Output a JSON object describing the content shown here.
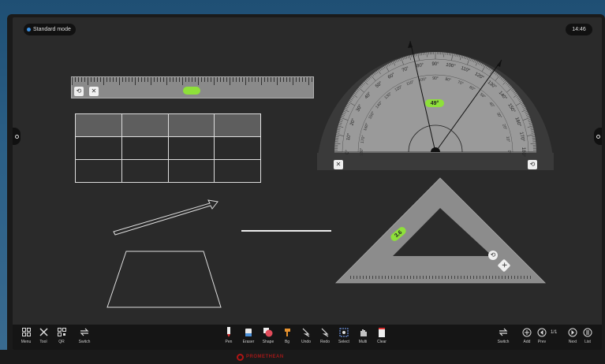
{
  "status": {
    "mode_label": "Standard mode",
    "clock": "14:46"
  },
  "protractor": {
    "angle_label": "49°",
    "outer_scale": [
      "0°",
      "10°",
      "20°",
      "30°",
      "40°",
      "50°",
      "60°",
      "70°",
      "80°",
      "90°",
      "100°",
      "110°",
      "120°",
      "130°",
      "140°",
      "150°",
      "160°",
      "170°",
      "180°"
    ],
    "inner_scale": [
      "180°",
      "170°",
      "160°",
      "150°",
      "140°",
      "130°",
      "120°",
      "110°",
      "100°",
      "90°",
      "80°",
      "70°",
      "60°",
      "50°",
      "40°",
      "30°",
      "20°",
      "10°",
      "0°"
    ]
  },
  "ruler": {
    "handle_label": ""
  },
  "triangle_ruler": {
    "handle_label": "3.6"
  },
  "toolbar": {
    "left": [
      {
        "label": "Menu",
        "icon": "menu-grid-icon"
      },
      {
        "label": "Tool",
        "icon": "tools-icon"
      },
      {
        "label": "QR",
        "icon": "qr-icon"
      },
      {
        "label": "Switch",
        "icon": "switch-icon"
      }
    ],
    "center": [
      {
        "label": "Pen",
        "icon": "pen-icon"
      },
      {
        "label": "Eraser",
        "icon": "eraser-icon"
      },
      {
        "label": "Shape",
        "icon": "shape-icon"
      },
      {
        "label": "Bg",
        "icon": "background-icon"
      },
      {
        "label": "Undo",
        "icon": "undo-icon"
      },
      {
        "label": "Redo",
        "icon": "redo-icon"
      },
      {
        "label": "Select",
        "icon": "select-icon"
      },
      {
        "label": "Multi",
        "icon": "multi-touch-icon"
      },
      {
        "label": "Clear",
        "icon": "clear-icon"
      }
    ],
    "right": [
      {
        "label": "Switch",
        "icon": "switch-icon"
      },
      {
        "label": "Add",
        "icon": "add-page-icon"
      },
      {
        "label": "Prev",
        "icon": "prev-page-icon"
      },
      {
        "label": "Next",
        "icon": "next-page-icon"
      },
      {
        "label": "List",
        "icon": "page-list-icon"
      }
    ],
    "page_indicator": "1/1"
  },
  "colors": {
    "accent_green": "#8ee03a",
    "canvas": "#2a2a2a",
    "toolbar": "#151515"
  }
}
